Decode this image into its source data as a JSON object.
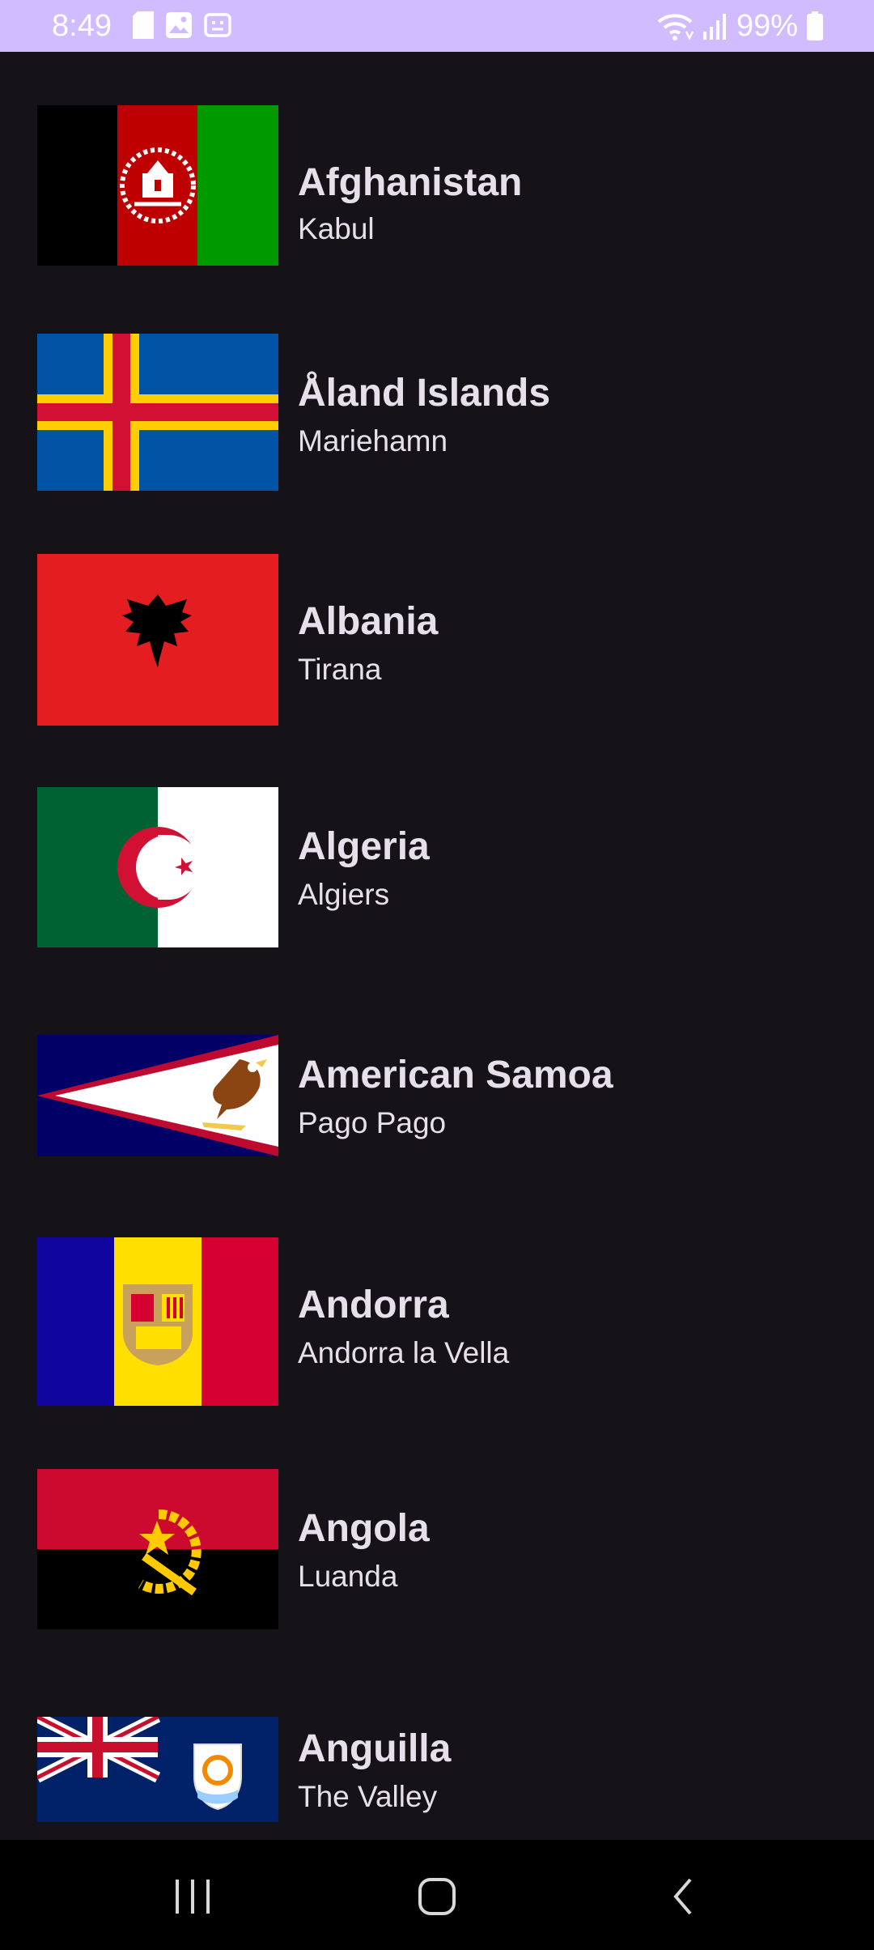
{
  "status_bar": {
    "time": "8:49",
    "battery": "99%",
    "left_icons": [
      "sim-card-icon",
      "image-icon",
      "screen-record-icon"
    ],
    "right_icons": [
      "wifi-icon",
      "signal-icon",
      "battery-icon"
    ]
  },
  "countries": [
    {
      "name": "Afghanistan",
      "capital": "Kabul",
      "flag": "afghanistan-flag"
    },
    {
      "name": "Åland Islands",
      "capital": "Mariehamn",
      "flag": "aland-flag"
    },
    {
      "name": "Albania",
      "capital": "Tirana",
      "flag": "albania-flag"
    },
    {
      "name": "Algeria",
      "capital": "Algiers",
      "flag": "algeria-flag"
    },
    {
      "name": "American Samoa",
      "capital": "Pago Pago",
      "flag": "american-samoa-flag"
    },
    {
      "name": "Andorra",
      "capital": "Andorra la Vella",
      "flag": "andorra-flag"
    },
    {
      "name": "Angola",
      "capital": "Luanda",
      "flag": "angola-flag"
    },
    {
      "name": "Anguilla",
      "capital": "The Valley",
      "flag": "anguilla-flag"
    }
  ],
  "nav_bar": {
    "buttons": [
      "recent-apps-icon",
      "home-icon",
      "back-icon"
    ]
  },
  "colors": {
    "background": "#151218",
    "status_bar": "#d0bcff",
    "text": "#e6e0ea",
    "nav_bar": "#000000"
  }
}
